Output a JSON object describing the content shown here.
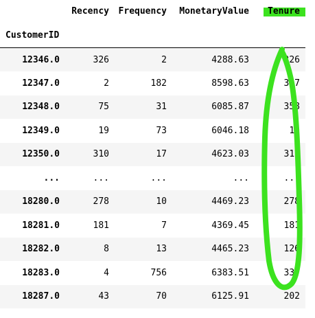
{
  "dataframe": {
    "columns": [
      "Recency",
      "Frequency",
      "MonetaryValue",
      "Tenure"
    ],
    "index_name": "CustomerID",
    "rows": [
      {
        "index": "12346.0",
        "values": [
          "326",
          "2",
          "4288.63",
          "326"
        ]
      },
      {
        "index": "12347.0",
        "values": [
          "2",
          "182",
          "8598.63",
          "367"
        ]
      },
      {
        "index": "12348.0",
        "values": [
          "75",
          "31",
          "6085.87",
          "358"
        ]
      },
      {
        "index": "12349.0",
        "values": [
          "19",
          "73",
          "6046.18",
          "19"
        ]
      },
      {
        "index": "12350.0",
        "values": [
          "310",
          "17",
          "4623.03",
          "310"
        ]
      },
      {
        "index": "...",
        "values": [
          "...",
          "...",
          "...",
          "..."
        ]
      },
      {
        "index": "18280.0",
        "values": [
          "278",
          "10",
          "4469.23",
          "278"
        ]
      },
      {
        "index": "18281.0",
        "values": [
          "181",
          "7",
          "4369.45",
          "181"
        ]
      },
      {
        "index": "18282.0",
        "values": [
          "8",
          "13",
          "4465.23",
          "126"
        ]
      },
      {
        "index": "18283.0",
        "values": [
          "4",
          "756",
          "6383.51",
          "337"
        ]
      },
      {
        "index": "18287.0",
        "values": [
          "43",
          "70",
          "6125.91",
          "202"
        ]
      }
    ]
  },
  "annotations": {
    "highlight_color": "#3ce21f",
    "highlighted_column": "Tenure",
    "marker_stroke_color": "#3ce21f"
  }
}
